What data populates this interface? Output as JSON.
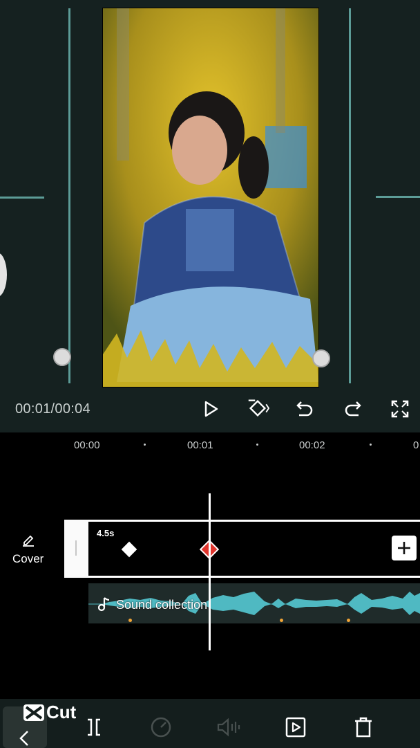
{
  "preview": {
    "timecode": "00:01/00:04"
  },
  "timeline": {
    "ticks": [
      "00:00",
      "00:01",
      "00:02",
      "0"
    ],
    "cover_label": "Cover",
    "clip_duration": "4.5s",
    "audio_label": "Sound collection"
  },
  "branding": {
    "logo_text": "Cut"
  },
  "colors": {
    "accent_teal": "#5c9c97",
    "waveform": "#4fb9c2",
    "keyframe_active": "#e0342c",
    "background": "#141e1d"
  },
  "icons": {
    "controls": [
      "play-icon",
      "keyframe-icon",
      "undo-icon",
      "redo-icon",
      "fullscreen-icon"
    ],
    "tools": [
      "back-icon",
      "split-icon",
      "speed-icon",
      "volume-icon",
      "animation-icon",
      "delete-icon"
    ]
  }
}
